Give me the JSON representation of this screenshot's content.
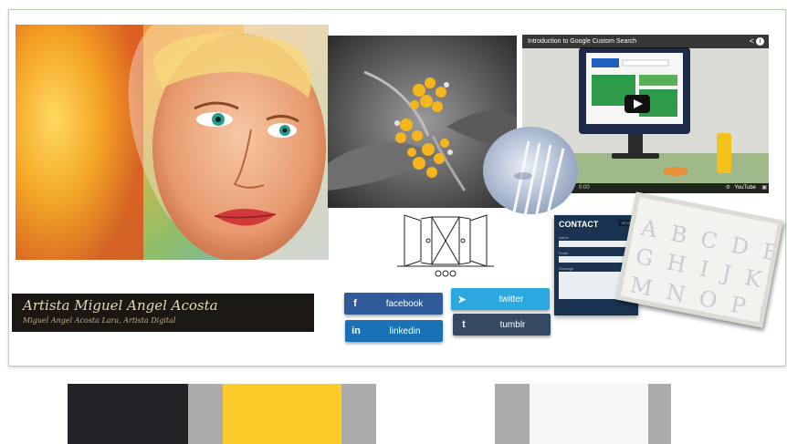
{
  "banner": {
    "title": "Artista Miguel Angel Acosta",
    "subtitle": "Miguel Angel Acosta Lara, Artista Digital"
  },
  "video": {
    "title": "Introduction to Google Custom Search",
    "screen_label": "YOUR SITE",
    "time": "0:00",
    "logo": "YouTube"
  },
  "social": {
    "facebook": "facebook",
    "twitter": "twitter",
    "linkedin": "linkedin",
    "tumblr": "tumblr"
  },
  "contact": {
    "title": "CONTACT",
    "button": "SEND",
    "fields": [
      "Name",
      "Email",
      "Message"
    ]
  },
  "letters": {
    "row1": "A B C D E F",
    "row2": "G H I J K L",
    "row3": "M N O P Q R"
  },
  "palette": {
    "colors": [
      "#222428",
      "#ababab",
      "#fccb2a",
      "#ababab",
      "#ffffff",
      "#ababab",
      "#f5f6f8",
      "#ababab"
    ]
  }
}
